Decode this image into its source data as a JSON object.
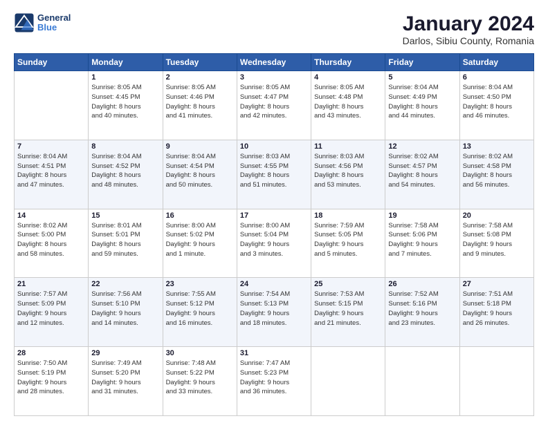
{
  "logo": {
    "text1": "General",
    "text2": "Blue"
  },
  "title": "January 2024",
  "subtitle": "Darlos, Sibiu County, Romania",
  "days_header": [
    "Sunday",
    "Monday",
    "Tuesday",
    "Wednesday",
    "Thursday",
    "Friday",
    "Saturday"
  ],
  "weeks": [
    [
      {
        "num": "",
        "detail": ""
      },
      {
        "num": "1",
        "detail": "Sunrise: 8:05 AM\nSunset: 4:45 PM\nDaylight: 8 hours\nand 40 minutes."
      },
      {
        "num": "2",
        "detail": "Sunrise: 8:05 AM\nSunset: 4:46 PM\nDaylight: 8 hours\nand 41 minutes."
      },
      {
        "num": "3",
        "detail": "Sunrise: 8:05 AM\nSunset: 4:47 PM\nDaylight: 8 hours\nand 42 minutes."
      },
      {
        "num": "4",
        "detail": "Sunrise: 8:05 AM\nSunset: 4:48 PM\nDaylight: 8 hours\nand 43 minutes."
      },
      {
        "num": "5",
        "detail": "Sunrise: 8:04 AM\nSunset: 4:49 PM\nDaylight: 8 hours\nand 44 minutes."
      },
      {
        "num": "6",
        "detail": "Sunrise: 8:04 AM\nSunset: 4:50 PM\nDaylight: 8 hours\nand 46 minutes."
      }
    ],
    [
      {
        "num": "7",
        "detail": "Sunrise: 8:04 AM\nSunset: 4:51 PM\nDaylight: 8 hours\nand 47 minutes."
      },
      {
        "num": "8",
        "detail": "Sunrise: 8:04 AM\nSunset: 4:52 PM\nDaylight: 8 hours\nand 48 minutes."
      },
      {
        "num": "9",
        "detail": "Sunrise: 8:04 AM\nSunset: 4:54 PM\nDaylight: 8 hours\nand 50 minutes."
      },
      {
        "num": "10",
        "detail": "Sunrise: 8:03 AM\nSunset: 4:55 PM\nDaylight: 8 hours\nand 51 minutes."
      },
      {
        "num": "11",
        "detail": "Sunrise: 8:03 AM\nSunset: 4:56 PM\nDaylight: 8 hours\nand 53 minutes."
      },
      {
        "num": "12",
        "detail": "Sunrise: 8:02 AM\nSunset: 4:57 PM\nDaylight: 8 hours\nand 54 minutes."
      },
      {
        "num": "13",
        "detail": "Sunrise: 8:02 AM\nSunset: 4:58 PM\nDaylight: 8 hours\nand 56 minutes."
      }
    ],
    [
      {
        "num": "14",
        "detail": "Sunrise: 8:02 AM\nSunset: 5:00 PM\nDaylight: 8 hours\nand 58 minutes."
      },
      {
        "num": "15",
        "detail": "Sunrise: 8:01 AM\nSunset: 5:01 PM\nDaylight: 8 hours\nand 59 minutes."
      },
      {
        "num": "16",
        "detail": "Sunrise: 8:00 AM\nSunset: 5:02 PM\nDaylight: 9 hours\nand 1 minute."
      },
      {
        "num": "17",
        "detail": "Sunrise: 8:00 AM\nSunset: 5:04 PM\nDaylight: 9 hours\nand 3 minutes."
      },
      {
        "num": "18",
        "detail": "Sunrise: 7:59 AM\nSunset: 5:05 PM\nDaylight: 9 hours\nand 5 minutes."
      },
      {
        "num": "19",
        "detail": "Sunrise: 7:58 AM\nSunset: 5:06 PM\nDaylight: 9 hours\nand 7 minutes."
      },
      {
        "num": "20",
        "detail": "Sunrise: 7:58 AM\nSunset: 5:08 PM\nDaylight: 9 hours\nand 9 minutes."
      }
    ],
    [
      {
        "num": "21",
        "detail": "Sunrise: 7:57 AM\nSunset: 5:09 PM\nDaylight: 9 hours\nand 12 minutes."
      },
      {
        "num": "22",
        "detail": "Sunrise: 7:56 AM\nSunset: 5:10 PM\nDaylight: 9 hours\nand 14 minutes."
      },
      {
        "num": "23",
        "detail": "Sunrise: 7:55 AM\nSunset: 5:12 PM\nDaylight: 9 hours\nand 16 minutes."
      },
      {
        "num": "24",
        "detail": "Sunrise: 7:54 AM\nSunset: 5:13 PM\nDaylight: 9 hours\nand 18 minutes."
      },
      {
        "num": "25",
        "detail": "Sunrise: 7:53 AM\nSunset: 5:15 PM\nDaylight: 9 hours\nand 21 minutes."
      },
      {
        "num": "26",
        "detail": "Sunrise: 7:52 AM\nSunset: 5:16 PM\nDaylight: 9 hours\nand 23 minutes."
      },
      {
        "num": "27",
        "detail": "Sunrise: 7:51 AM\nSunset: 5:18 PM\nDaylight: 9 hours\nand 26 minutes."
      }
    ],
    [
      {
        "num": "28",
        "detail": "Sunrise: 7:50 AM\nSunset: 5:19 PM\nDaylight: 9 hours\nand 28 minutes."
      },
      {
        "num": "29",
        "detail": "Sunrise: 7:49 AM\nSunset: 5:20 PM\nDaylight: 9 hours\nand 31 minutes."
      },
      {
        "num": "30",
        "detail": "Sunrise: 7:48 AM\nSunset: 5:22 PM\nDaylight: 9 hours\nand 33 minutes."
      },
      {
        "num": "31",
        "detail": "Sunrise: 7:47 AM\nSunset: 5:23 PM\nDaylight: 9 hours\nand 36 minutes."
      },
      {
        "num": "",
        "detail": ""
      },
      {
        "num": "",
        "detail": ""
      },
      {
        "num": "",
        "detail": ""
      }
    ]
  ]
}
